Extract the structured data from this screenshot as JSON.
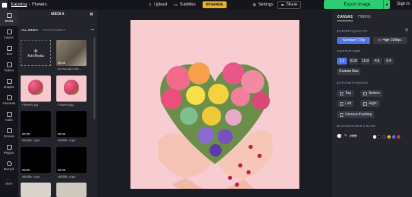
{
  "topbar": {
    "brand": "Kapwing",
    "separator": "›",
    "project": "Flowers",
    "upload": "Upload",
    "subtitles": "Subtitles",
    "upgrade": "UPGRADE",
    "settings": "Settings",
    "share": "Share",
    "export": "Export Image",
    "signin": "Sign In"
  },
  "rail": [
    {
      "label": "Media",
      "icon": "media-icon"
    },
    {
      "label": "Layers",
      "icon": "layers-icon"
    },
    {
      "label": "Text",
      "icon": "text-icon"
    },
    {
      "label": "Videos",
      "icon": "video-icon"
    },
    {
      "label": "Images",
      "icon": "image-icon"
    },
    {
      "label": "Elements",
      "icon": "elements-icon"
    },
    {
      "label": "Audio",
      "icon": "audio-icon"
    },
    {
      "label": "Scenes",
      "icon": "scenes-icon"
    },
    {
      "label": "Plugins",
      "icon": "plugins-icon"
    },
    {
      "label": "Record",
      "icon": "record-icon"
    },
    {
      "label": "More",
      "icon": "more-icon"
    }
  ],
  "media": {
    "title": "MEDIA",
    "tabs": [
      "ALL MEDIA",
      "THIS PROJECT"
    ],
    "add": "Add Media",
    "items": [
      {
        "duration": "00:30",
        "caption": "20-Wonder Girl..."
      },
      {
        "caption": "Flowers.jpg"
      },
      {
        "caption": "Flowers.jpg"
      },
      {
        "duration": "00:30",
        "caption": "Wildlife .mp4"
      },
      {
        "duration": "00:30",
        "caption": "Wildlife .mp4"
      },
      {
        "duration": "00:30",
        "caption": "Wildlife .mp4"
      },
      {
        "duration": "00:30",
        "caption": "Wildlife .mp4"
      }
    ]
  },
  "right": {
    "tabs": [
      "CANVAS",
      "TIMING"
    ],
    "export_quality": "EXPORT QUALITY",
    "standard": "Standard 720p",
    "high": "High 1080p+",
    "output_size": "OUTPUT SIZE",
    "sizes": [
      "1:1",
      "9:16",
      "16:9",
      "4:5",
      "5:4"
    ],
    "custom": "Custom Size",
    "expand_padding": "EXPAND PADDING",
    "top": "Top",
    "bottom": "Bottom",
    "left": "Left",
    "right": "Right",
    "remove_padding": "Remove Padding",
    "background_color": "BACKGROUND COLOR",
    "hex": "#ffffff",
    "swatches": [
      "#ffffff",
      "#000000",
      "#1f2027",
      "#e8b02c",
      "#4b74e6",
      "#e23d3d"
    ]
  }
}
